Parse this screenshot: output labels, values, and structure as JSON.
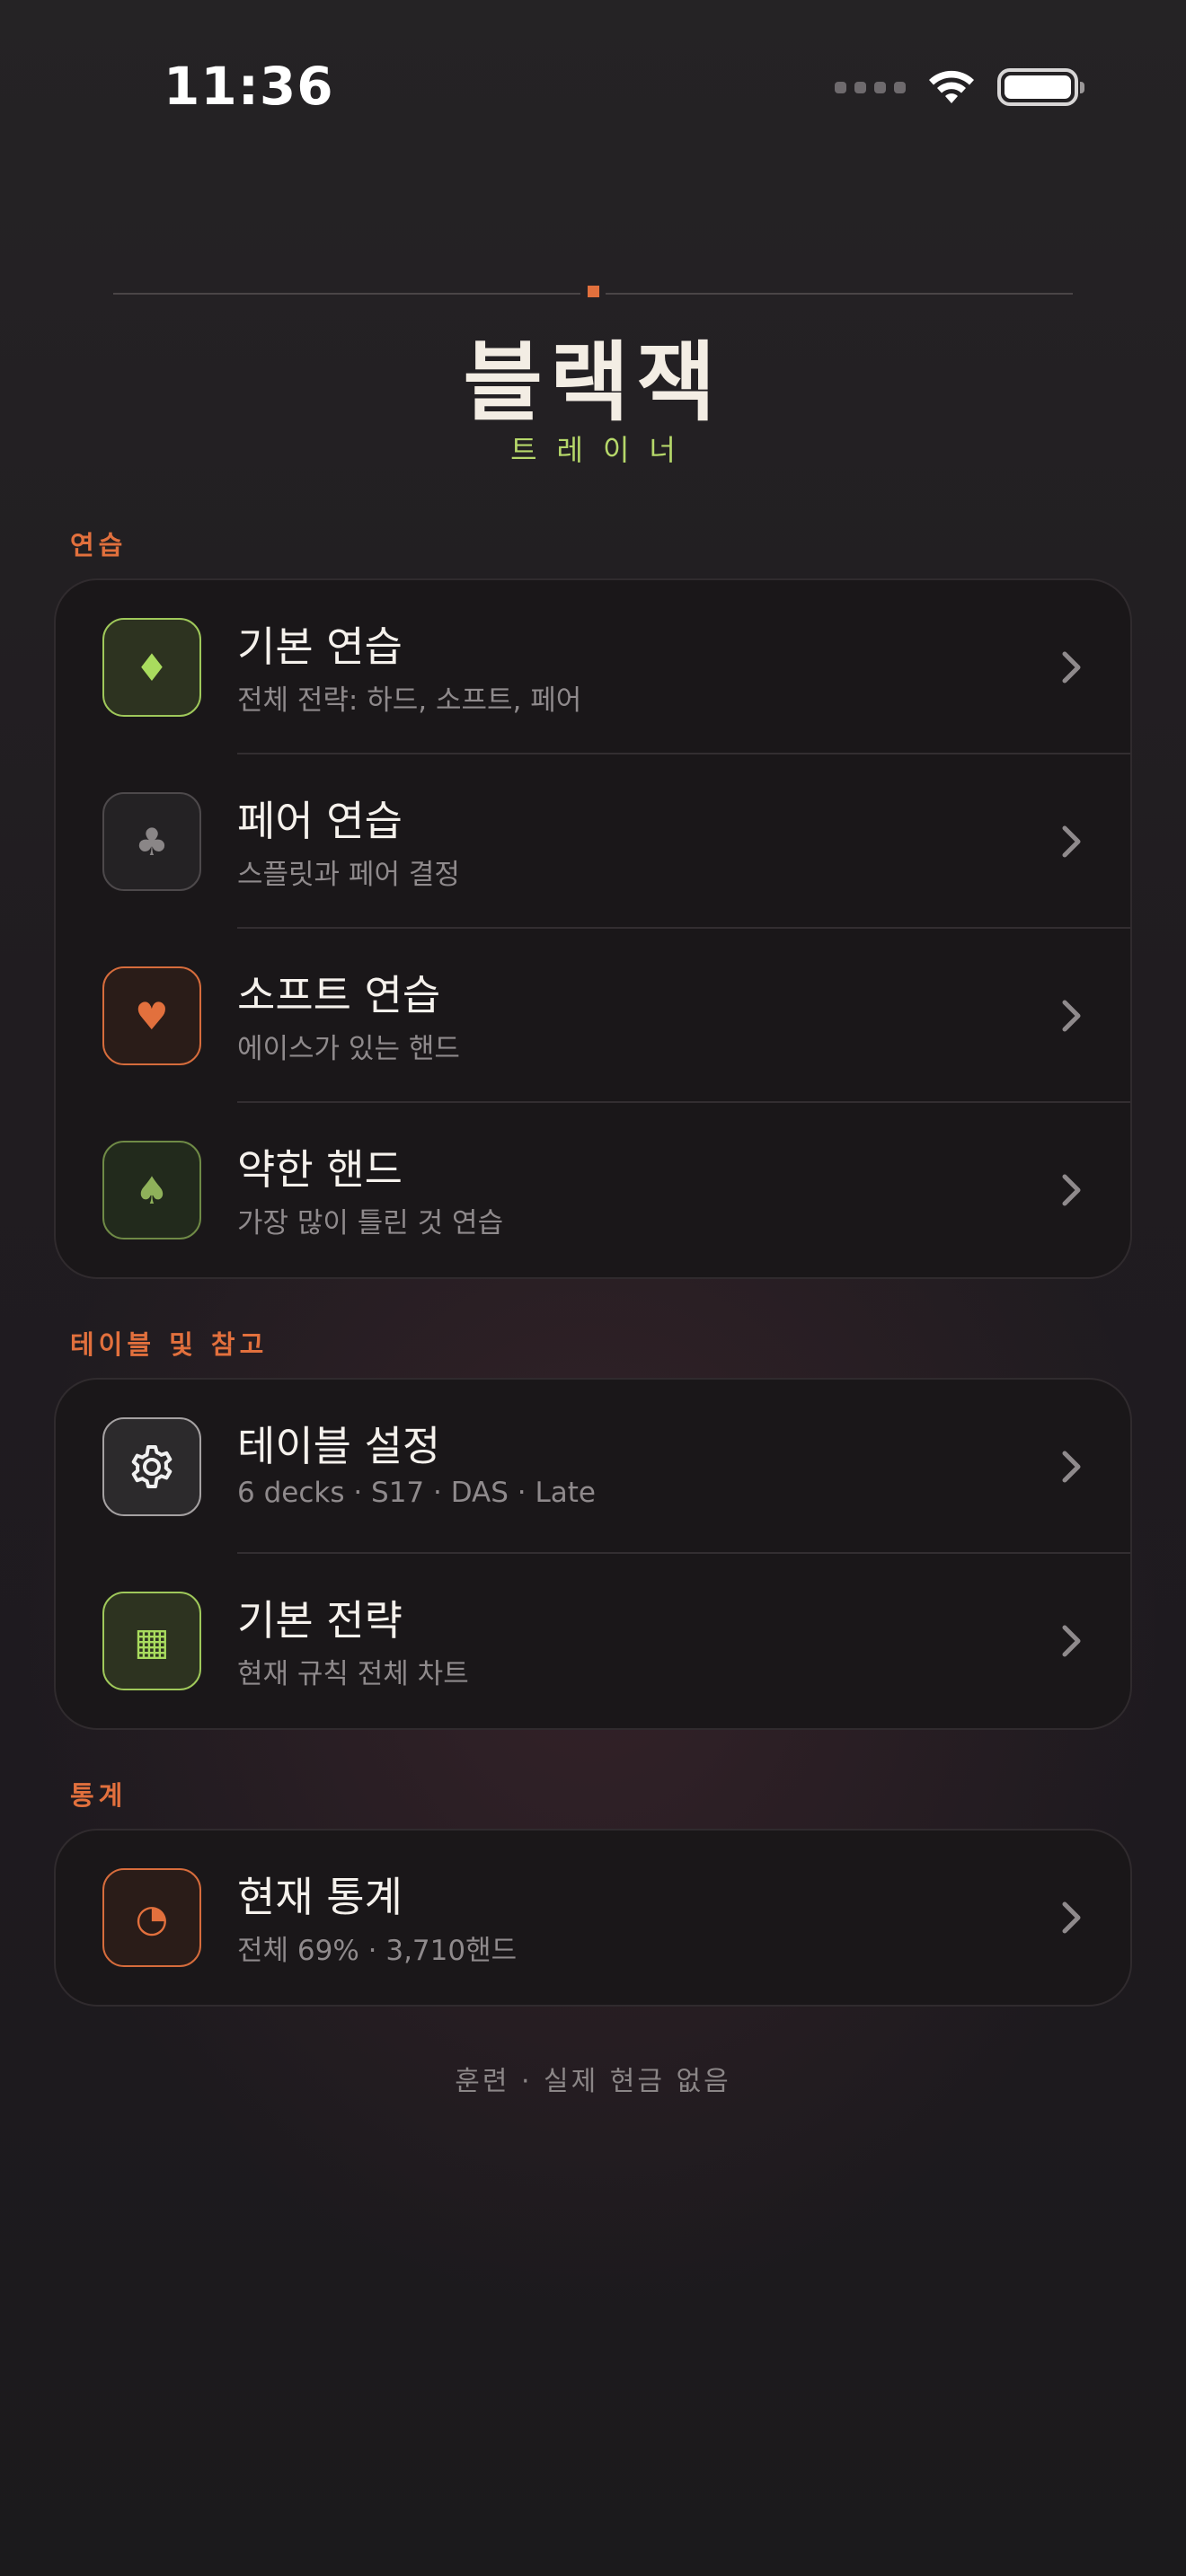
{
  "status_bar": {
    "time": "11:36",
    "icons": [
      "cellular-icon",
      "wifi-icon",
      "battery-icon"
    ]
  },
  "header": {
    "title": "블랙잭",
    "subtitle": "트레이너",
    "accent_color": "#e2703d",
    "subtitle_color": "#b6d86a"
  },
  "sections": [
    {
      "label": "연습",
      "items": [
        {
          "icon": "diamond-icon",
          "glyph": "♦",
          "title": "기본 연습",
          "subtitle": "전체 전략: 하드, 소프트, 페어"
        },
        {
          "icon": "club-icon",
          "glyph": "♣",
          "title": "페어 연습",
          "subtitle": "스플릿과 페어 결정"
        },
        {
          "icon": "heart-icon",
          "glyph": "♥",
          "title": "소프트 연습",
          "subtitle": "에이스가 있는 핸드"
        },
        {
          "icon": "spade-icon",
          "glyph": "♠",
          "title": "약한 핸드",
          "subtitle": "가장 많이 틀린 것 연습"
        }
      ]
    },
    {
      "label": "테이블 및 참고",
      "items": [
        {
          "icon": "gear-icon",
          "glyph": "",
          "title": "테이블 설정",
          "subtitle": "6 decks · S17 · DAS · Late"
        },
        {
          "icon": "grid-icon",
          "glyph": "▦",
          "title": "기본 전략",
          "subtitle": "현재 규칙 전체 차트"
        }
      ]
    },
    {
      "label": "통계",
      "items": [
        {
          "icon": "pie-chart-icon",
          "glyph": "◔",
          "title": "현재 통계",
          "subtitle": "전체 69% · 3,710핸드"
        }
      ]
    }
  ],
  "footer": "훈련 · 실제 현금 없음"
}
